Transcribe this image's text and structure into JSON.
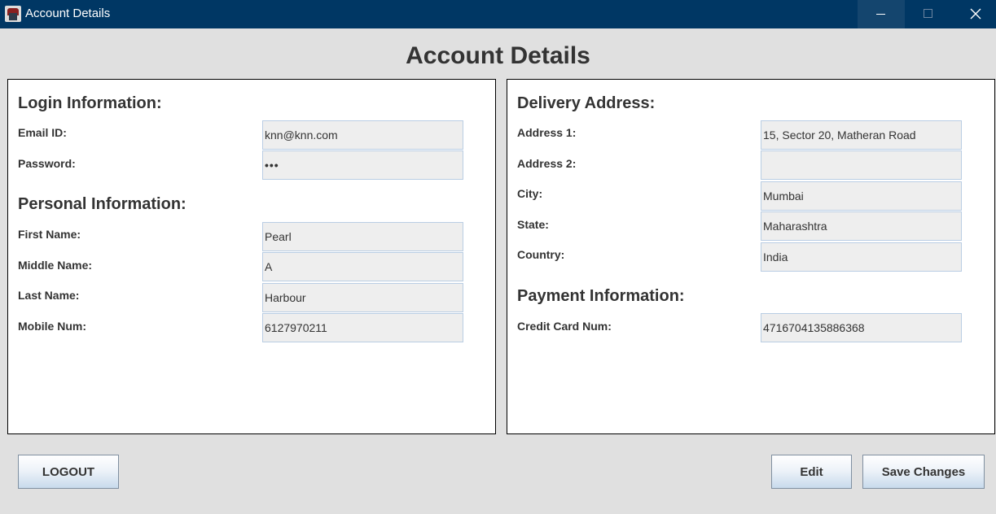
{
  "window": {
    "title": "Account Details",
    "icon": "java-app-icon",
    "controls": [
      "minimize-icon",
      "maximize-icon",
      "close-icon"
    ]
  },
  "page_title": "Account Details",
  "login": {
    "heading": "Login Information:",
    "email_label": "Email ID:",
    "email_value": "knn@knn.com",
    "password_label": "Password:",
    "password_value": "•••"
  },
  "personal": {
    "heading": "Personal Information:",
    "first_name_label": "First Name:",
    "first_name_value": "Pearl",
    "middle_name_label": "Middle Name:",
    "middle_name_value": "A",
    "last_name_label": "Last Name:",
    "last_name_value": "Harbour",
    "mobile_label": "Mobile Num:",
    "mobile_value": "6127970211"
  },
  "delivery": {
    "heading": "Delivery Address:",
    "address1_label": "Address 1:",
    "address1_value": "15, Sector 20, Matheran Road",
    "address2_label": "Address 2:",
    "address2_value": "",
    "city_label": "City:",
    "city_value": "Mumbai",
    "state_label": "State:",
    "state_value": "Maharashtra",
    "country_label": "Country:",
    "country_value": "India"
  },
  "payment": {
    "heading": "Payment Information:",
    "card_label": "Credit Card Num:",
    "card_value": "4716704135886368"
  },
  "buttons": {
    "logout": "LOGOUT",
    "edit": "Edit",
    "save": "Save Changes"
  },
  "colors": {
    "titlebar": "#003764",
    "background": "#e0e0e0",
    "field_bg": "#eeeeee",
    "field_border": "#b9cde3"
  }
}
